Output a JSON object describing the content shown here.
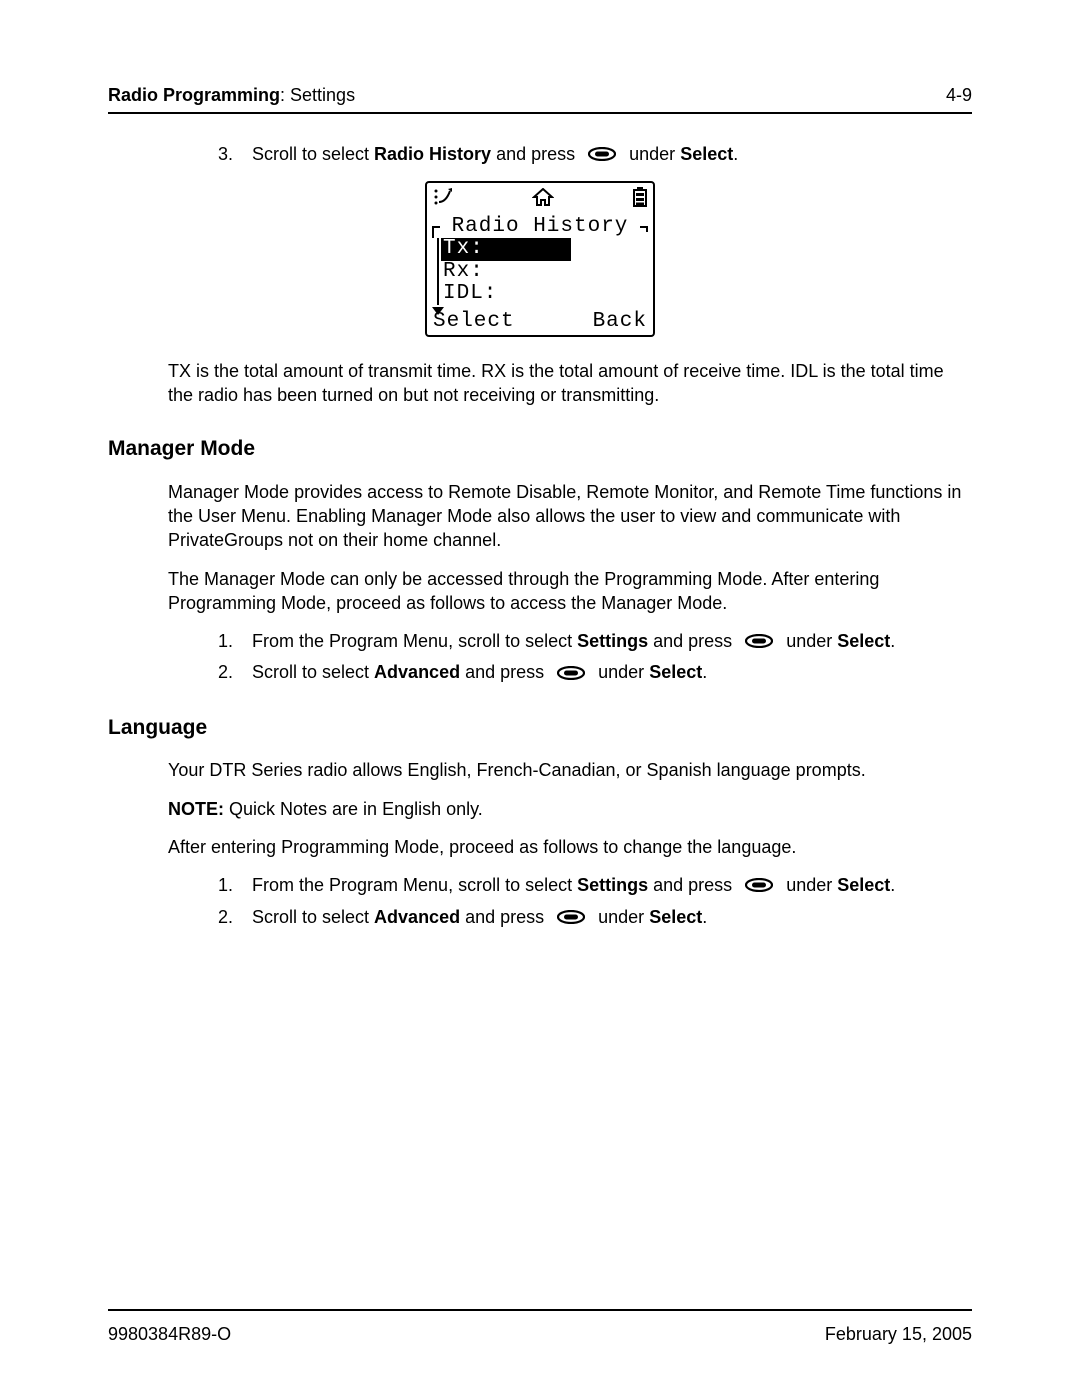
{
  "header": {
    "section_bold": "Radio Programming",
    "section_rest": ": Settings",
    "page_number": "4-9"
  },
  "steps_top": {
    "num": "3.",
    "pre": "Scroll to select ",
    "bold1": "Radio History",
    "mid": " and press ",
    "after_icon": " under ",
    "bold2": "Select",
    "end": "."
  },
  "lcd": {
    "title": "Radio History",
    "rows": [
      "Tx:",
      "Rx:",
      "IDL:"
    ],
    "soft_left": "Select",
    "soft_right": "Back"
  },
  "tx_desc": "TX is the total amount of transmit time. RX is the total amount of receive time. IDL is the total time the radio has been turned on but not receiving or transmitting.",
  "manager": {
    "heading": "Manager Mode",
    "p1": "Manager Mode provides access to Remote Disable, Remote Monitor, and Remote Time functions in the User Menu. Enabling Manager Mode also allows the user to view and communicate with PrivateGroups not on their home channel.",
    "p2": "The Manager Mode can only be accessed through the Programming Mode. After entering Programming Mode, proceed as follows to access the Manager Mode.",
    "step1": {
      "num": "1.",
      "pre": "From the Program Menu, scroll to select ",
      "bold1": "Settings",
      "mid": " and press ",
      "after_icon": " under ",
      "bold2": "Select",
      "end": "."
    },
    "step2": {
      "num": "2.",
      "pre": "Scroll to select ",
      "bold1": "Advanced",
      "mid": " and press ",
      "after_icon": " under ",
      "bold2": "Select",
      "end": "."
    }
  },
  "language": {
    "heading": "Language",
    "p1": "Your DTR Series radio allows English, French-Canadian, or Spanish language prompts.",
    "note_bold": "NOTE:",
    "note_rest": "  Quick Notes are in English only.",
    "p3": "After entering Programming Mode, proceed as follows to change the language.",
    "step1": {
      "num": "1.",
      "pre": "From the Program Menu, scroll to select ",
      "bold1": "Settings",
      "mid": " and press ",
      "after_icon": " under ",
      "bold2": "Select",
      "end": "."
    },
    "step2": {
      "num": "2.",
      "pre": "Scroll to select ",
      "bold1": "Advanced",
      "mid": " and press ",
      "after_icon": " under ",
      "bold2": "Select",
      "end": "."
    }
  },
  "footer": {
    "left": "9980384R89-O",
    "right": "February 15, 2005"
  }
}
